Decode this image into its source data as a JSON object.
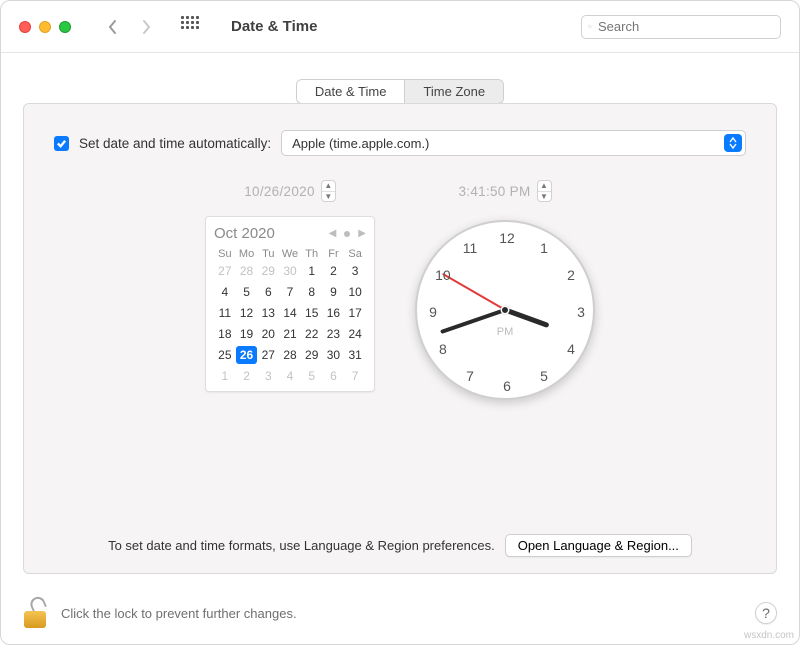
{
  "header": {
    "title": "Date & Time",
    "search_placeholder": "Search"
  },
  "tabs": {
    "date_time": "Date & Time",
    "time_zone": "Time Zone"
  },
  "auto": {
    "label": "Set date and time automatically:",
    "server": "Apple (time.apple.com.)"
  },
  "date_field": "10/26/2020",
  "time_field": "3:41:50 PM",
  "calendar": {
    "title": "Oct 2020",
    "dow": [
      "Su",
      "Mo",
      "Tu",
      "We",
      "Th",
      "Fr",
      "Sa"
    ],
    "weeks": [
      [
        {
          "d": "27",
          "o": 1
        },
        {
          "d": "28",
          "o": 1
        },
        {
          "d": "29",
          "o": 1
        },
        {
          "d": "30",
          "o": 1
        },
        {
          "d": "1"
        },
        {
          "d": "2"
        },
        {
          "d": "3"
        }
      ],
      [
        {
          "d": "4"
        },
        {
          "d": "5"
        },
        {
          "d": "6"
        },
        {
          "d": "7"
        },
        {
          "d": "8"
        },
        {
          "d": "9"
        },
        {
          "d": "10"
        }
      ],
      [
        {
          "d": "11"
        },
        {
          "d": "12"
        },
        {
          "d": "13"
        },
        {
          "d": "14"
        },
        {
          "d": "15"
        },
        {
          "d": "16"
        },
        {
          "d": "17"
        }
      ],
      [
        {
          "d": "18"
        },
        {
          "d": "19"
        },
        {
          "d": "20"
        },
        {
          "d": "21"
        },
        {
          "d": "22"
        },
        {
          "d": "23"
        },
        {
          "d": "24"
        }
      ],
      [
        {
          "d": "25"
        },
        {
          "d": "26",
          "s": 1
        },
        {
          "d": "27"
        },
        {
          "d": "28"
        },
        {
          "d": "29"
        },
        {
          "d": "30"
        },
        {
          "d": "31"
        }
      ],
      [
        {
          "d": "1",
          "o": 1
        },
        {
          "d": "2",
          "o": 1
        },
        {
          "d": "3",
          "o": 1
        },
        {
          "d": "4",
          "o": 1
        },
        {
          "d": "5",
          "o": 1
        },
        {
          "d": "6",
          "o": 1
        },
        {
          "d": "7",
          "o": 1
        }
      ]
    ]
  },
  "clock": {
    "hours": [
      "12",
      "1",
      "2",
      "3",
      "4",
      "5",
      "6",
      "7",
      "8",
      "9",
      "10",
      "11"
    ],
    "ampm": "PM",
    "hour_angle": 110,
    "minute_angle": 251,
    "second_angle": 300
  },
  "formats_tip": "To set date and time formats, use Language & Region preferences.",
  "open_lang_btn": "Open Language & Region...",
  "lock_text": "Click the lock to prevent further changes.",
  "help": "?",
  "watermark": "wsxdn.com"
}
